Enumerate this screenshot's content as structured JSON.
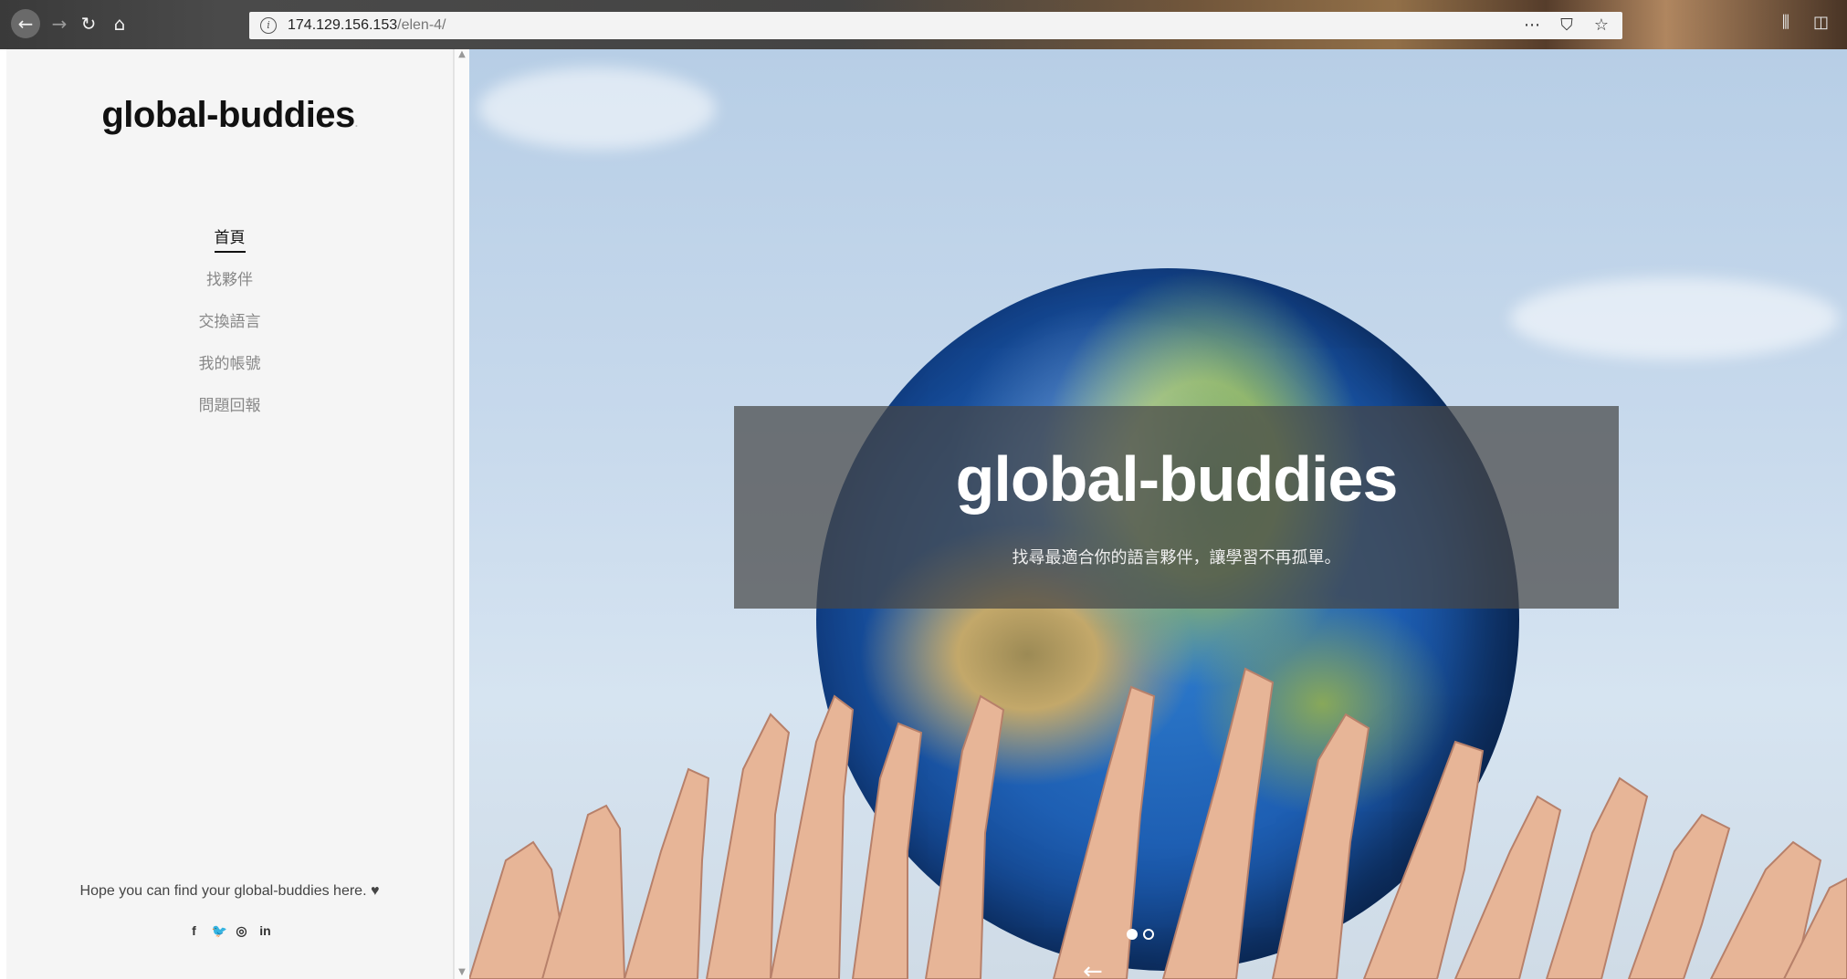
{
  "browser": {
    "url_host": "174.129.156.153",
    "url_path": "/elen-4/",
    "icons": [
      "back-arrow-icon",
      "forward-arrow-icon",
      "reload-icon",
      "home-icon",
      "info-icon",
      "more-icon",
      "pocket-icon",
      "bookmark-star-icon",
      "library-icon",
      "sidebar-icon"
    ]
  },
  "sidebar": {
    "logo": "global-buddies",
    "logo_dot": ".",
    "menu": [
      {
        "label": "首頁",
        "active": true
      },
      {
        "label": "找夥伴",
        "active": false
      },
      {
        "label": "交換語言",
        "active": false
      },
      {
        "label": "我的帳號",
        "active": false
      },
      {
        "label": "問題回報",
        "active": false
      }
    ],
    "tagline": "Hope you can find your global-buddies here. ♥",
    "social": [
      "f",
      "🐦",
      "◎",
      "in"
    ]
  },
  "hero": {
    "title": "global-buddies",
    "subtitle": "找尋最適合你的語言夥伴，讓學習不再孤單。",
    "slides_total": 2,
    "slide_active": 1
  },
  "colors": {
    "sidebar_bg": "#f5f5f5",
    "active_menu": "#111111",
    "inactive_menu": "#888888",
    "overlay": "#464646"
  }
}
